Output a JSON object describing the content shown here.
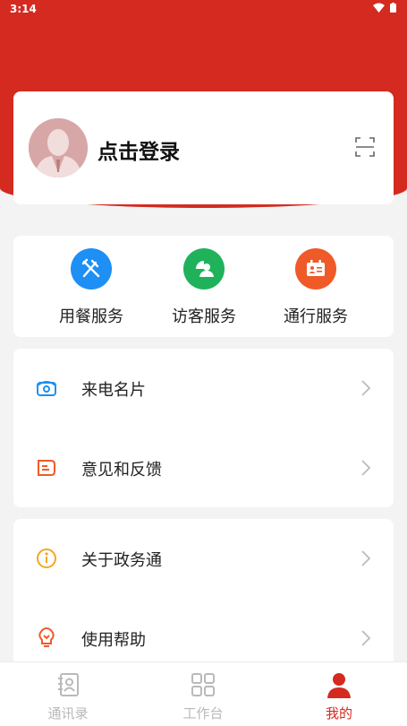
{
  "status_bar": {
    "time": "3:14"
  },
  "profile": {
    "login_text": "点击登录"
  },
  "services": [
    {
      "label": "用餐服务",
      "icon": "dining-icon",
      "color": "#1e8ff5"
    },
    {
      "label": "访客服务",
      "icon": "visitor-icon",
      "color": "#1fb25a"
    },
    {
      "label": "通行服务",
      "icon": "pass-icon",
      "color": "#ef5a28"
    }
  ],
  "menu_group_1": [
    {
      "label": "来电名片",
      "icon": "phone-card-icon"
    },
    {
      "label": "意见和反馈",
      "icon": "feedback-icon"
    }
  ],
  "menu_group_2": [
    {
      "label": "关于政务通",
      "icon": "info-icon"
    },
    {
      "label": "使用帮助",
      "icon": "lightbulb-icon"
    }
  ],
  "tabbar": {
    "tabs": [
      {
        "label": "通讯录",
        "icon": "contacts-icon",
        "active": false
      },
      {
        "label": "工作台",
        "icon": "workbench-icon",
        "active": false
      },
      {
        "label": "我的",
        "icon": "user-icon",
        "active": true
      }
    ]
  },
  "colors": {
    "brand_red": "#d42a20",
    "background": "#f3f3f3"
  }
}
